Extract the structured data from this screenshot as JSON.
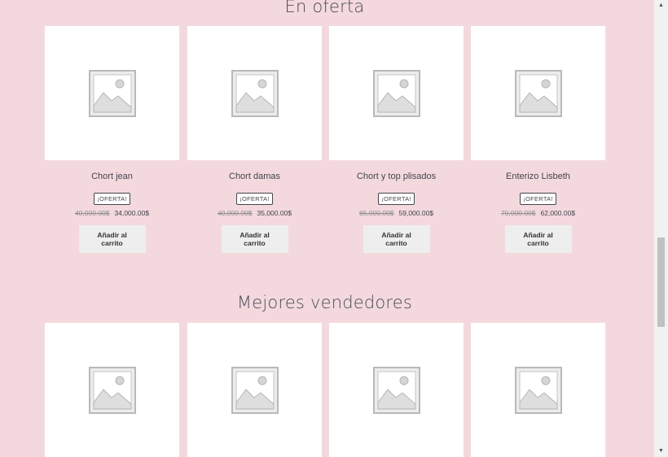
{
  "sections": [
    {
      "title": "En oferta",
      "products": [
        {
          "name": "Chort jean",
          "badge": "¡OFERTA!",
          "old_price": "40,000.00$",
          "price": "34,000.00$",
          "button": "Añadir al carrito"
        },
        {
          "name": "Chort damas",
          "badge": "¡OFERTA!",
          "old_price": "40,000.00$",
          "price": "35,000.00$",
          "button": "Añadir al carrito"
        },
        {
          "name": "Chort y top plisados",
          "badge": "¡OFERTA!",
          "old_price": "65,000.00$",
          "price": "59,000.00$",
          "button": "Añadir al carrito"
        },
        {
          "name": "Enterizo Lisbeth",
          "badge": "¡OFERTA!",
          "old_price": "70,000.00$",
          "price": "62,000.00$",
          "button": "Añadir al carrito"
        }
      ]
    },
    {
      "title": "Mejores vendedores"
    }
  ],
  "colors": {
    "background": "#f3d9de",
    "card": "#ffffff",
    "button": "#eeeeee"
  },
  "icons": {
    "placeholder": "image-placeholder-icon",
    "scroll_up": "scroll-up-arrow-icon",
    "scroll_down": "scroll-down-arrow-icon"
  }
}
